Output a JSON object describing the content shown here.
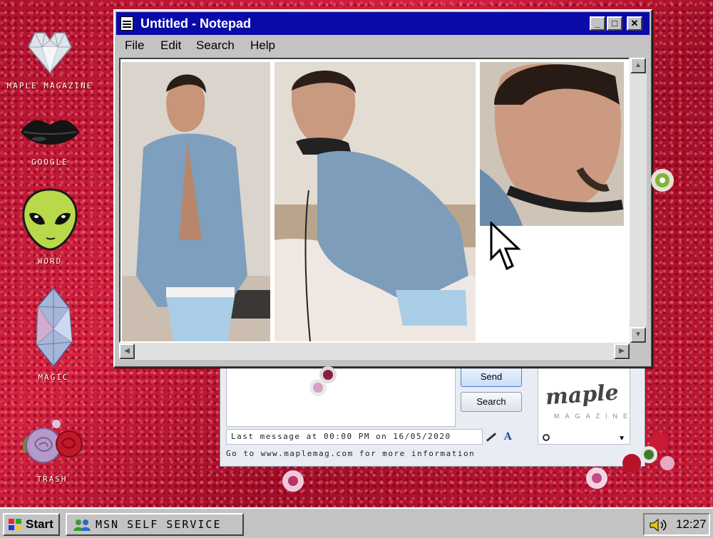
{
  "desktop": {
    "icons": [
      {
        "label": "MAPLE MAGAZINE",
        "icon": "diamond-heart-icon"
      },
      {
        "label": "GOOGLE",
        "icon": "lips-icon"
      },
      {
        "label": "WORD",
        "icon": "alien-icon"
      },
      {
        "label": "MAGIC",
        "icon": "crystal-icon"
      },
      {
        "label": "TRASH",
        "icon": "roses-icon"
      }
    ]
  },
  "notepad": {
    "title": "Untitled - Notepad",
    "controls": {
      "minimize": "_",
      "maximize": "□",
      "close": "✕"
    },
    "menu": [
      "File",
      "Edit",
      "Search",
      "Help"
    ]
  },
  "msn": {
    "send_label": "Send",
    "search_label": "Search",
    "status_text": "Last message at 00:00 PM on 16/05/2020",
    "info_text": "Go to www.maplemag.com for more information",
    "display_logo": "maple",
    "display_sub": "MAGAZINE",
    "format_font": "A"
  },
  "taskbar": {
    "start_label": "Start",
    "task_label": "MSN SELF SERVICE",
    "clock": "12:27"
  },
  "colors": {
    "titlebar": "#0a0aa8",
    "desktop": "#c8183a",
    "chrome": "#c3c3c3"
  }
}
